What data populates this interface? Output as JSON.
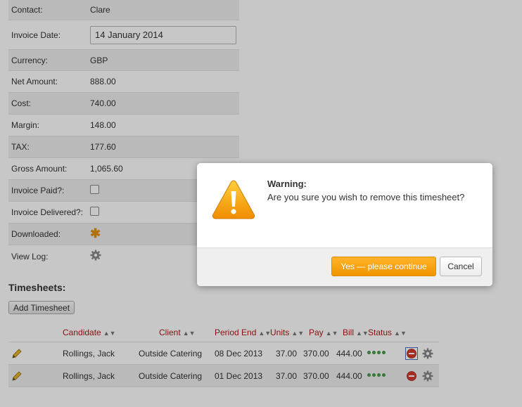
{
  "details": {
    "contact": {
      "label": "Contact:",
      "value": "Clare"
    },
    "invoice_date": {
      "label": "Invoice Date:",
      "value": "14 January 2014"
    },
    "currency": {
      "label": "Currency:",
      "value": "GBP"
    },
    "net_amount": {
      "label": "Net Amount:",
      "value": "888.00"
    },
    "cost": {
      "label": "Cost:",
      "value": "740.00"
    },
    "margin": {
      "label": "Margin:",
      "value": "148.00"
    },
    "tax": {
      "label": "TAX:",
      "value": "177.60"
    },
    "gross_amount": {
      "label": "Gross Amount:",
      "value": "1,065.60"
    },
    "invoice_paid": {
      "label": "Invoice Paid?:"
    },
    "invoice_delivered": {
      "label": "Invoice Delivered?:"
    },
    "downloaded": {
      "label": "Downloaded:"
    },
    "view_log": {
      "label": "View Log:"
    }
  },
  "timesheets": {
    "title": "Timesheets:",
    "add_button": "Add Timesheet",
    "columns": {
      "candidate": "Candidate",
      "client": "Client",
      "period_end": "Period End",
      "units": "Units",
      "pay": "Pay",
      "bill": "Bill",
      "status": "Status"
    },
    "rows": [
      {
        "candidate": "Rollings, Jack",
        "client": "Outside Catering",
        "period_end": "08 Dec 2013",
        "units": "37.00",
        "pay": "370.00",
        "bill": "444.00"
      },
      {
        "candidate": "Rollings, Jack",
        "client": "Outside Catering",
        "period_end": "01 Dec 2013",
        "units": "37.00",
        "pay": "370.00",
        "bill": "444.00"
      }
    ]
  },
  "dialog": {
    "title": "Warning:",
    "message": "Are you sure you wish to remove this timesheet?",
    "confirm_label": "Yes — please continue",
    "cancel_label": "Cancel"
  },
  "colors": {
    "header_text": "#b01818",
    "accent_button": "#f29400",
    "status_dot": "#4a9a4a"
  }
}
